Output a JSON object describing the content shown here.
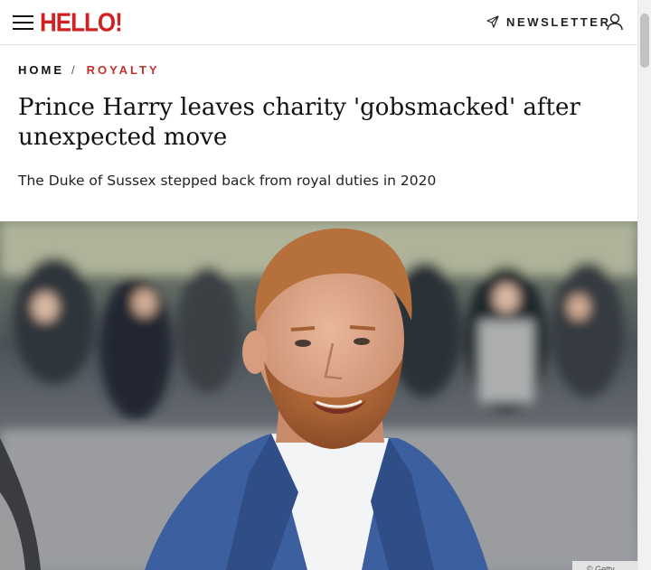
{
  "header": {
    "logo_text": "HELLO!",
    "newsletter_label": "NEWSLETTER",
    "logo_color": "#d21f1f"
  },
  "breadcrumb": {
    "home": "HOME",
    "separator": "/",
    "category": "ROYALTY",
    "category_color": "#c0322b"
  },
  "article": {
    "title": "Prince Harry leaves charity 'gobsmacked' after unexpected move",
    "subtitle": "The Duke of Sussex stepped back from royal duties in 2020",
    "image_credit": "© Getty"
  },
  "icons": [
    "menu-icon",
    "send-icon",
    "user-icon"
  ]
}
